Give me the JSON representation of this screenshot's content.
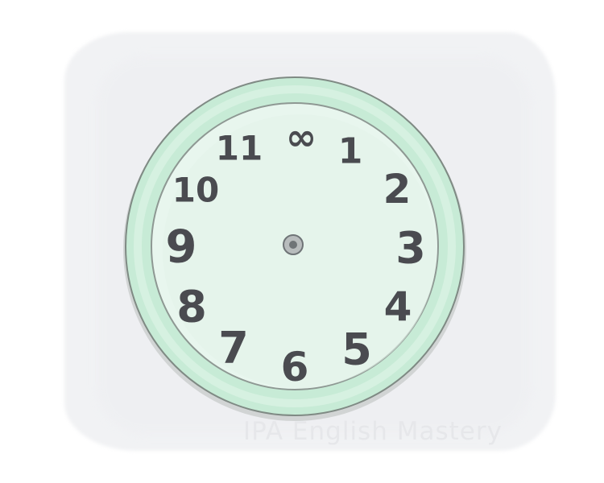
{
  "clock": {
    "numerals": [
      "∞",
      "1",
      "2",
      "3",
      "4",
      "5",
      "6",
      "7",
      "8",
      "9",
      "10",
      "11"
    ],
    "rim_color": "#c7ebd6",
    "face_color": "#e8f6ee",
    "numeral_color": "#4a4b50"
  },
  "watermark": {
    "text": "IPA English Mastery"
  }
}
